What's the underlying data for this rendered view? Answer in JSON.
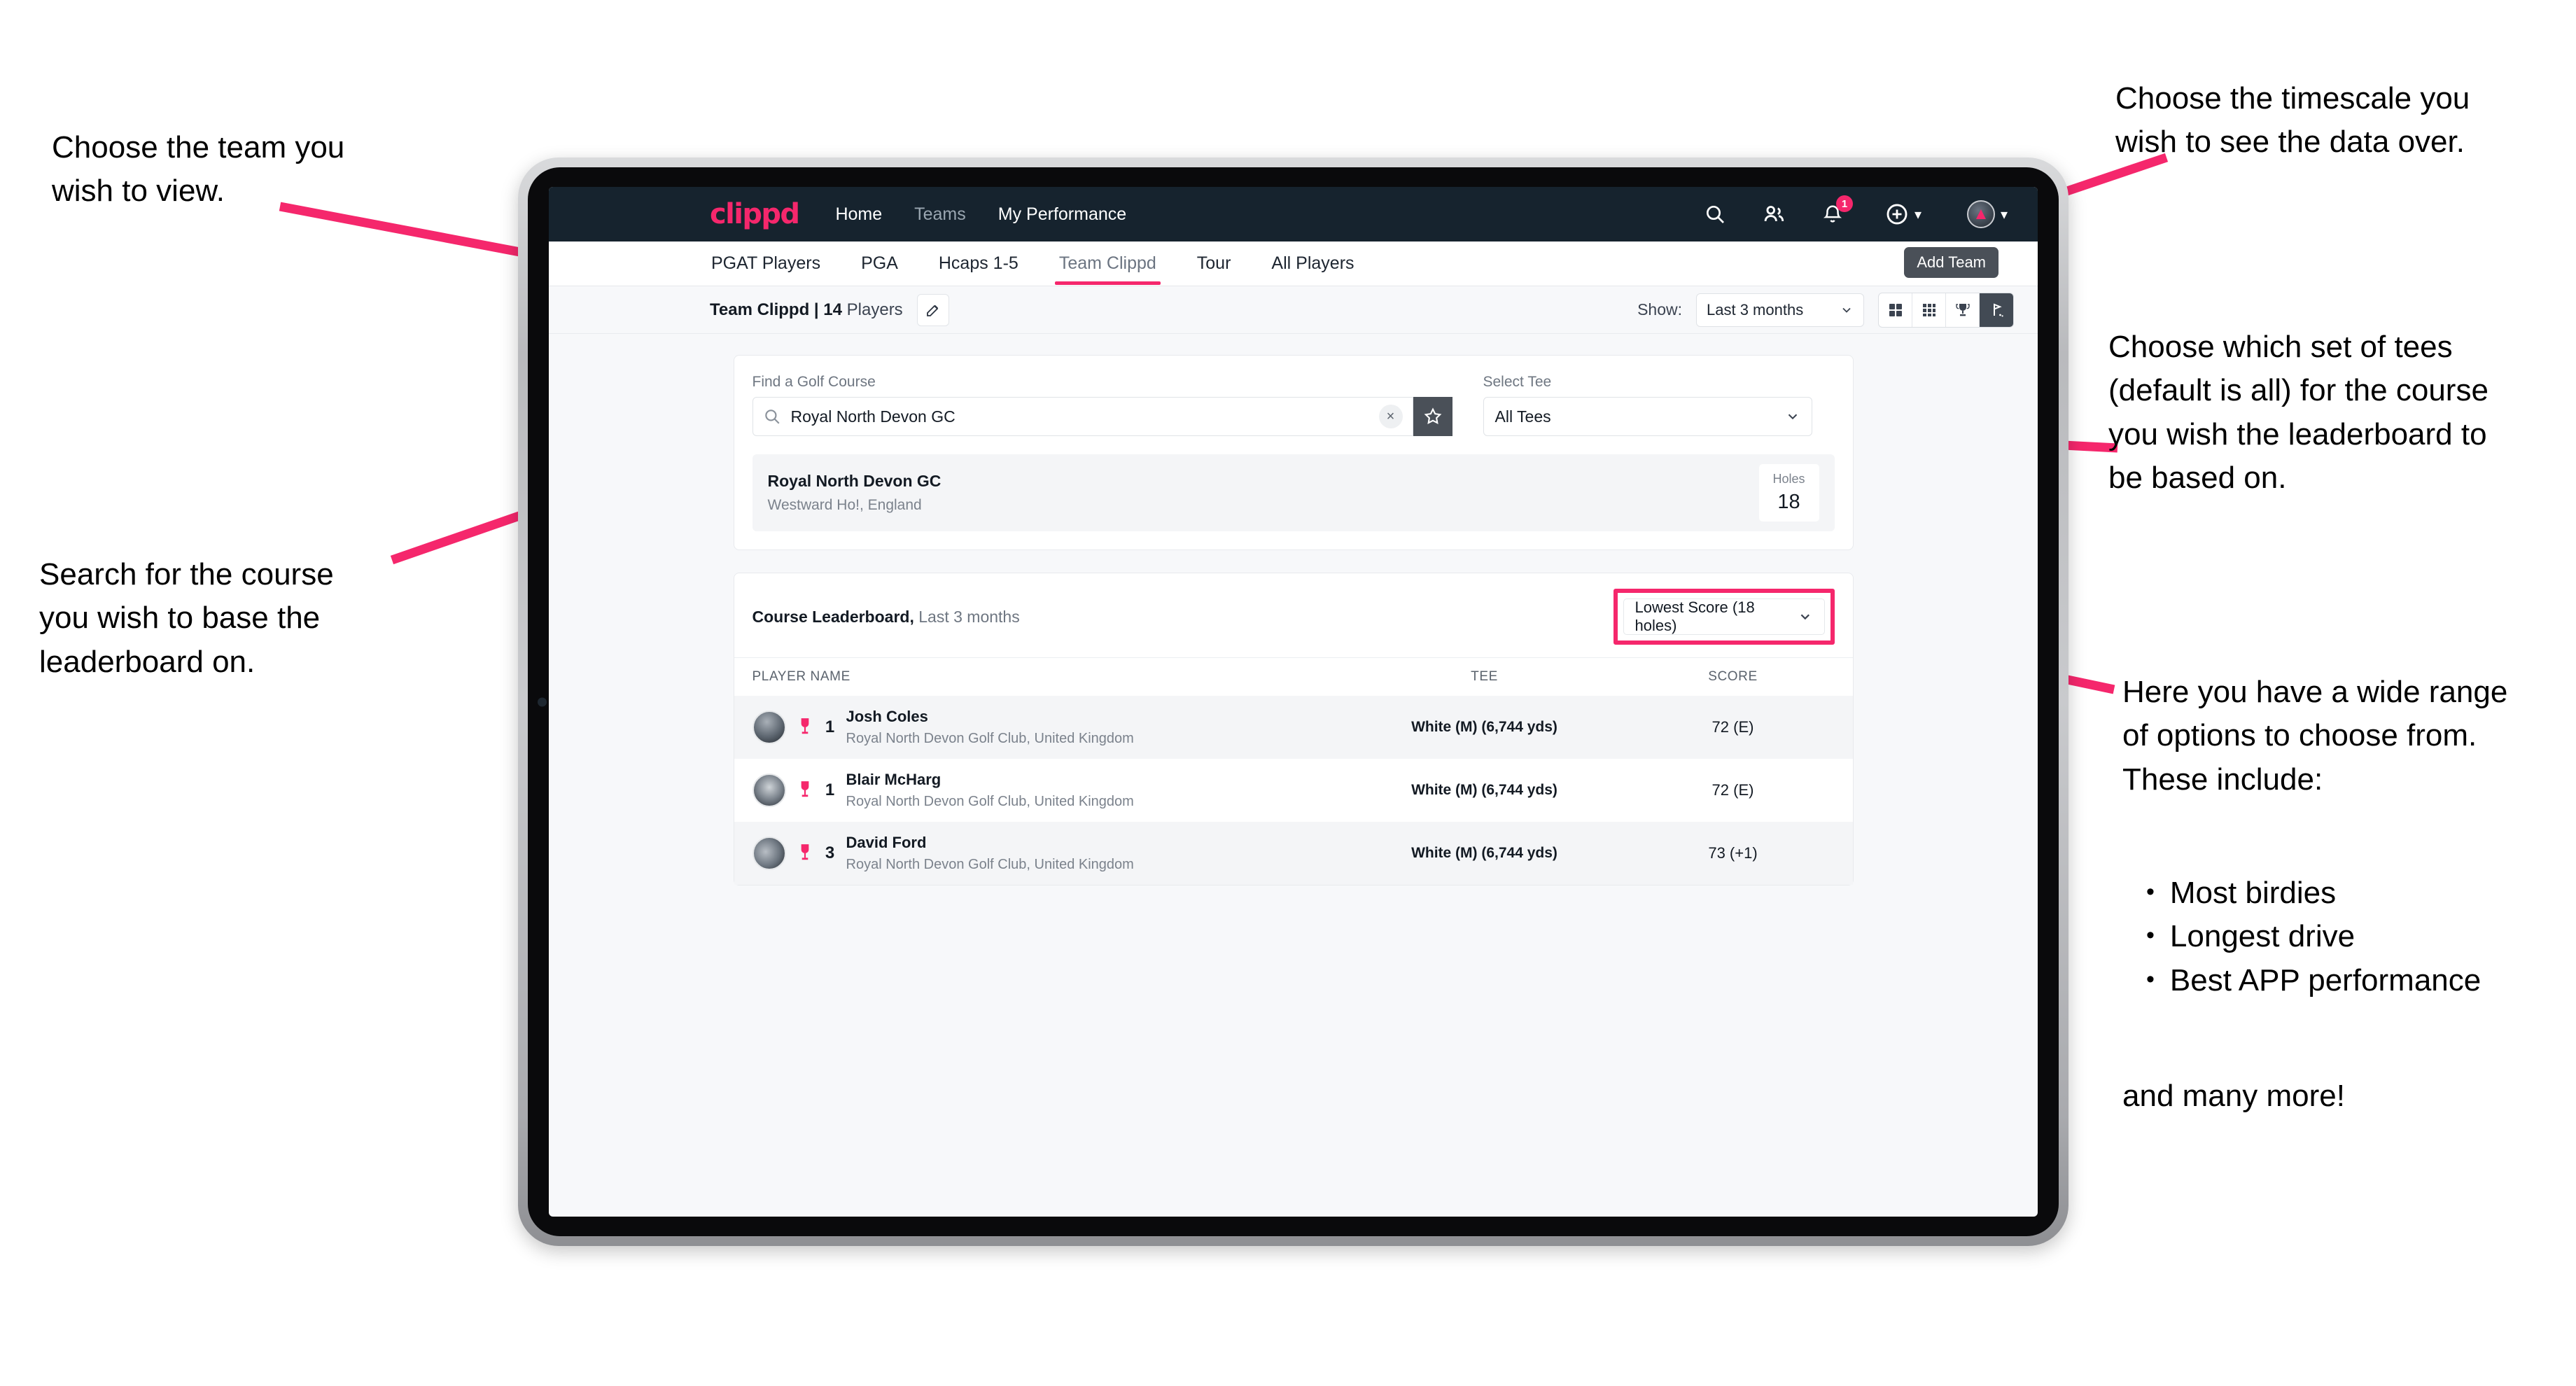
{
  "annotations": {
    "team": "Choose the team you\nwish to view.",
    "timescale": "Choose the timescale you\nwish to see the data over.",
    "tees": "Choose which set of tees\n(default is all) for the course\nyou wish the leaderboard to\nbe based on.",
    "search": "Search for the course\nyou wish to base the\nleaderboard on.",
    "options_intro": "Here you have a wide range\nof options to choose from.\nThese include:",
    "options_bullets": [
      "Most birdies",
      "Longest drive",
      "Best APP performance"
    ],
    "options_outro": "and many more!",
    "bullet_glyph": "•"
  },
  "colors": {
    "accent": "#f5276c",
    "navbar": "#16232e",
    "page_bg": "#f7f8fa",
    "dark_button": "#4a5058"
  },
  "navbar": {
    "brand": "clippd",
    "links": [
      {
        "label": "Home",
        "dim": false
      },
      {
        "label": "Teams",
        "dim": true
      },
      {
        "label": "My Performance",
        "dim": false
      }
    ],
    "icons": [
      {
        "name": "search-icon"
      },
      {
        "name": "people-icon"
      },
      {
        "name": "bell-icon",
        "badge": "1"
      },
      {
        "name": "plus-circle-icon"
      },
      {
        "name": "avatar-icon"
      }
    ],
    "notification_count": "1"
  },
  "tabs": [
    {
      "label": "PGAT Players",
      "active": false
    },
    {
      "label": "PGA",
      "active": false
    },
    {
      "label": "Hcaps 1-5",
      "active": false
    },
    {
      "label": "Team Clippd",
      "active": true
    },
    {
      "label": "Tour",
      "active": false
    },
    {
      "label": "All Players",
      "active": false
    }
  ],
  "toolbar": {
    "team_name": "Team Clippd | 14",
    "team_players_suffix": " Players",
    "edit_tooltip": "Add Team",
    "show_label": "Show:",
    "period_value": "Last 3 months",
    "view_buttons": [
      {
        "name": "grid-view-icon",
        "active": false
      },
      {
        "name": "dots-grid-view-icon",
        "active": false
      },
      {
        "name": "trophy-view-icon",
        "active": false
      },
      {
        "name": "golf-flag-view-icon",
        "active": true
      }
    ]
  },
  "search_card": {
    "course_label": "Find a Golf Course",
    "course_value": "Royal North Devon GC",
    "course_placeholder": "Find a Golf Course",
    "clear_glyph": "×",
    "tee_label": "Select Tee",
    "tee_value": "All Tees",
    "course_result": {
      "name": "Royal North Devon GC",
      "location": "Westward Ho!, England",
      "holes_label": "Holes",
      "holes_value": "18"
    }
  },
  "leaderboard": {
    "title": "Course Leaderboard,",
    "subtitle": " Last 3 months",
    "metric_value": "Lowest Score (18 holes)",
    "columns": {
      "player": "PLAYER NAME",
      "tee": "TEE",
      "score": "SCORE"
    },
    "rows": [
      {
        "rank": "1",
        "name": "Josh Coles",
        "club": "Royal North Devon Golf Club, United Kingdom",
        "tee": "White (M) (6,744 yds)",
        "score": "72 (E)"
      },
      {
        "rank": "1",
        "name": "Blair McHarg",
        "club": "Royal North Devon Golf Club, United Kingdom",
        "tee": "White (M) (6,744 yds)",
        "score": "72 (E)"
      },
      {
        "rank": "3",
        "name": "David Ford",
        "club": "Royal North Devon Golf Club, United Kingdom",
        "tee": "White (M) (6,744 yds)",
        "score": "73 (+1)"
      }
    ]
  }
}
